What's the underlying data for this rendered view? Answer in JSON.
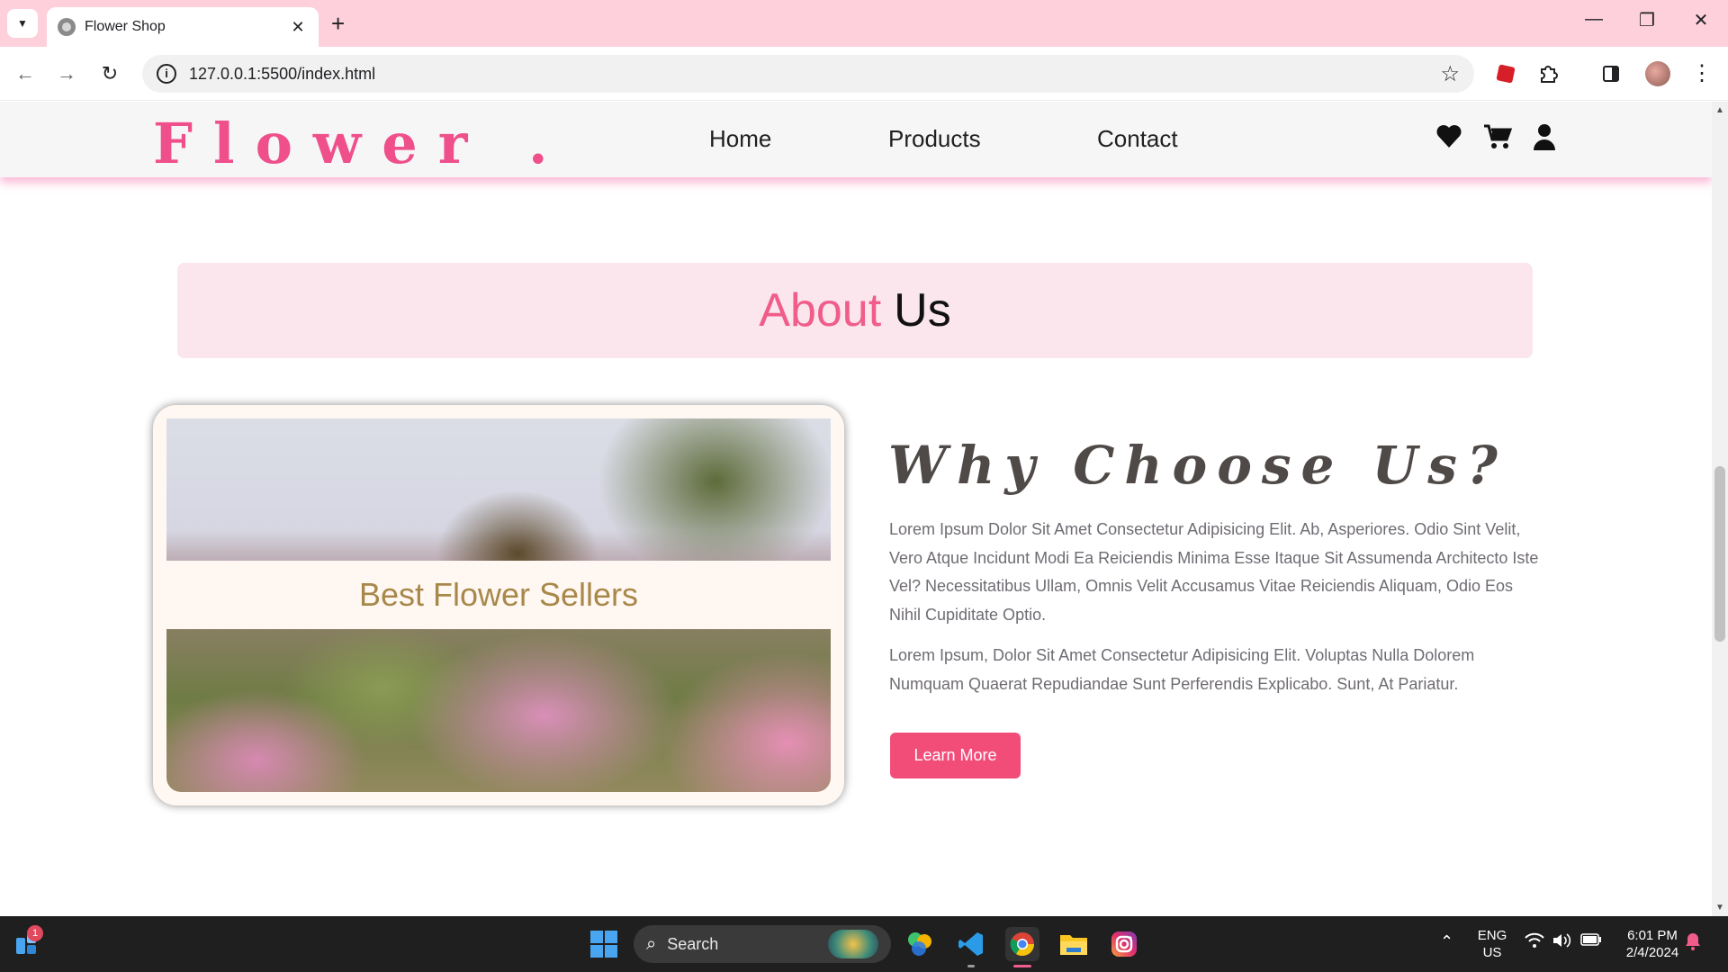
{
  "browser": {
    "tab_title": "Flower Shop",
    "tab_close": "✕",
    "new_tab": "+",
    "url": "127.0.0.1:5500/index.html",
    "info": "i",
    "window_controls": {
      "minimize": "—",
      "restore": "❐",
      "close": "✕"
    },
    "nav": {
      "back": "←",
      "forward": "→",
      "reload": "↻"
    },
    "star": "☆"
  },
  "site": {
    "logo": "Flower .",
    "nav": [
      "Home",
      "Products",
      "Contact"
    ],
    "icons": [
      "heart-icon",
      "cart-icon",
      "user-icon"
    ],
    "about_title_accent": "About",
    "about_title_rest": "Us",
    "card_caption": "Best Flower Sellers",
    "why_title": "Why Choose Us?",
    "paragraph_1": "Lorem Ipsum Dolor Sit Amet Consectetur Adipisicing Elit. Ab, Asperiores. Odio Sint Velit, Vero Atque Incidunt Modi Ea Reiciendis Minima Esse Itaque Sit Assumenda Architecto Iste Vel? Necessitatibus Ullam, Omnis Velit Accusamus Vitae Reiciendis Aliquam, Odio Eos Nihil Cupiditate Optio.",
    "paragraph_2": "Lorem Ipsum, Dolor Sit Amet Consectetur Adipisicing Elit. Voluptas Nulla Dolorem Numquam Quaerat Repudiandae Sunt Perferendis Explicabo. Sunt, At Pariatur.",
    "learn_more": "Learn More"
  },
  "taskbar": {
    "search_placeholder": "Search",
    "notification_count": "1",
    "lang_line1": "ENG",
    "lang_line2": "US",
    "time": "6:01 PM",
    "date": "2/4/2024"
  },
  "colors": {
    "accent_pink": "#f05d8a",
    "button_pink": "#f24d79",
    "tabbar_pink": "#fdd0dc",
    "banner_pink": "#fbe6ee"
  }
}
